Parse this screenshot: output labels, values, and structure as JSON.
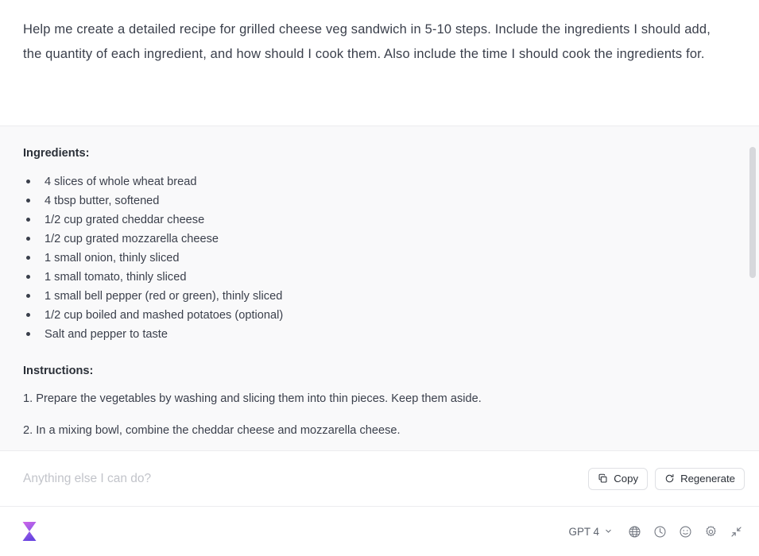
{
  "prompt": {
    "text": "Help me create a detailed recipe for grilled cheese veg sandwich in 5-10 steps. Include the ingredients I should add, the quantity of each ingredient, and how should I cook them. Also include the time I should cook the ingredients for."
  },
  "response": {
    "ingredients_heading": "Ingredients:",
    "ingredients": [
      "4 slices of whole wheat bread",
      "4 tbsp butter, softened",
      "1/2 cup grated cheddar cheese",
      "1/2 cup grated mozzarella cheese",
      "1 small onion, thinly sliced",
      "1 small tomato, thinly sliced",
      "1 small bell pepper (red or green), thinly sliced",
      "1/2 cup boiled and mashed potatoes (optional)",
      "Salt and pepper to taste"
    ],
    "instructions_heading": "Instructions:",
    "steps": [
      "1. Prepare the vegetables by washing and slicing them into thin pieces. Keep them aside.",
      "2. In a mixing bowl, combine the cheddar cheese and mozzarella cheese."
    ]
  },
  "composer": {
    "value": "",
    "placeholder": "Anything else I can do?",
    "copy_label": "Copy",
    "regenerate_label": "Regenerate"
  },
  "footer": {
    "model_label": "GPT 4",
    "icons": [
      "globe-icon",
      "clock-icon",
      "smiley-icon",
      "gear-icon",
      "collapse-icon"
    ]
  },
  "colors": {
    "panel_bg": "#f9f9fa",
    "body_text": "#3a3f4b",
    "heading_text": "#2b3038",
    "placeholder": "#c2c4ca",
    "border": "#ececee",
    "brand_purple": "#7c4dff",
    "brand_magenta": "#d264e8"
  }
}
